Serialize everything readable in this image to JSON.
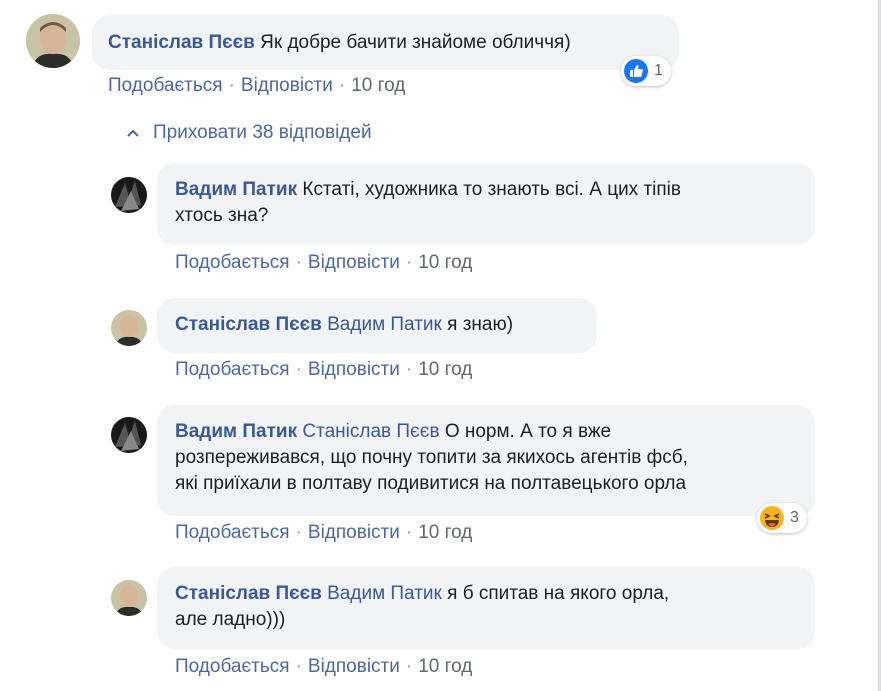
{
  "comments": [
    {
      "author": "Станіслав Пєєв",
      "mention": "",
      "text": "Як добре бачити знайоме обличчя)",
      "like_label": "Подобається",
      "reply_label": "Відповісти",
      "time": "10 год",
      "reaction": {
        "icon": "like-icon",
        "count": "1",
        "color": "#1877f2"
      }
    },
    {
      "author": "Вадим Патик",
      "mention": "",
      "text_line1": "Кстаті, художника то знають всі. А цих тіпів",
      "text_line2": "хтось зна?",
      "like_label": "Подобається",
      "reply_label": "Відповісти",
      "time": "10 год"
    },
    {
      "author": "Станіслав Пєєв",
      "mention": "Вадим Патик",
      "text": "я знаю)",
      "like_label": "Подобається",
      "reply_label": "Відповісти",
      "time": "10 год"
    },
    {
      "author": "Вадим Патик",
      "mention": "Станіслав Пєєв",
      "text_line1": "О норм. А то я вже",
      "text_line2": "розпереживався, що почну топити за якихось агентів фсб,",
      "text_line3": "які приїхали в полтаву подивитися на полтавецького орла",
      "like_label": "Подобається",
      "reply_label": "Відповісти",
      "time": "10 год",
      "reaction": {
        "icon": "haha-icon",
        "count": "3",
        "color": "#f7b125"
      }
    },
    {
      "author": "Станіслав Пєєв",
      "mention": "Вадим Патик",
      "text_line1": "я б спитав на якого орла,",
      "text_line2": "але ладно)))",
      "like_label": "Подобається",
      "reply_label": "Відповісти",
      "time": "10 год"
    }
  ],
  "hide_replies_label": "Приховати 38 відповідей",
  "colors": {
    "link": "#385898",
    "bubble": "#f2f3f5",
    "meta": "#616770"
  }
}
